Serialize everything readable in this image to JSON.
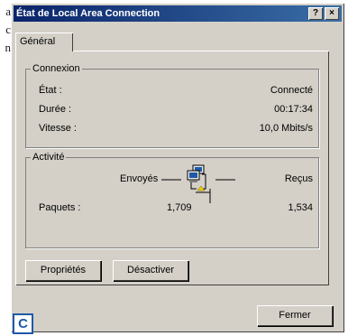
{
  "margin_text": [
    "a",
    "c",
    "n"
  ],
  "window": {
    "title": "État de Local Area Connection",
    "help_label": "?",
    "close_label": "×"
  },
  "tabs": [
    {
      "label": "Général"
    }
  ],
  "connexion": {
    "label": "Connexion",
    "rows": [
      {
        "label": "État :",
        "value": "Connecté"
      },
      {
        "label": "Durée :",
        "value": "00:17:34"
      },
      {
        "label": "Vitesse :",
        "value": "10,0 Mbits/s"
      }
    ]
  },
  "activite": {
    "label": "Activité",
    "sent_label": "Envoyés",
    "received_label": "Reçus",
    "packets_label": "Paquets :",
    "sent_value": "1,709",
    "received_value": "1,534"
  },
  "buttons": {
    "properties": "Propriétés",
    "disable": "Désactiver",
    "close": "Fermer"
  },
  "corner_letter": "C",
  "icons": {
    "network": "network-activity-icon"
  }
}
